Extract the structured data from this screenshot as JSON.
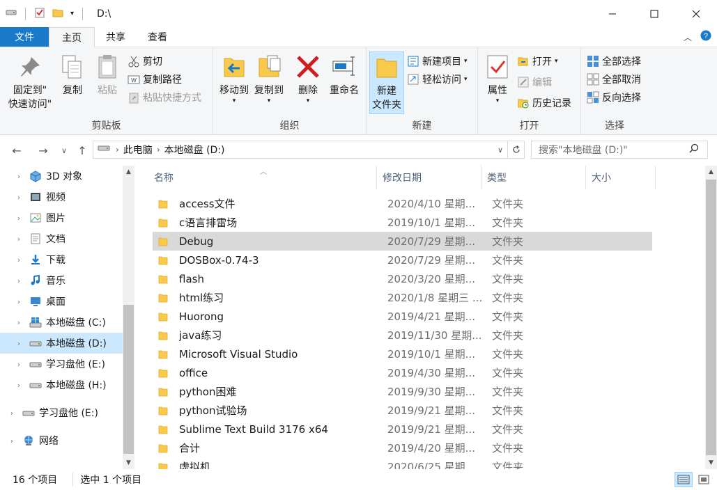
{
  "window": {
    "path_title": "D:\\"
  },
  "tabs": {
    "file": "文件",
    "home": "主页",
    "share": "共享",
    "view": "查看"
  },
  "ribbon": {
    "clipboard": {
      "label": "剪贴板",
      "pin": "固定到\"快速访问\"",
      "pin_line1": "固定到\"",
      "pin_line2": "快速访问\"",
      "copy": "复制",
      "paste": "粘贴",
      "cut": "剪切",
      "copy_path": "复制路径",
      "paste_shortcut": "粘贴快捷方式"
    },
    "organize": {
      "label": "组织",
      "move_to": "移动到",
      "copy_to": "复制到",
      "delete": "删除",
      "rename": "重命名"
    },
    "new": {
      "label": "新建",
      "new_folder_line1": "新建",
      "new_folder_line2": "文件夹",
      "new_item": "新建项目",
      "easy_access": "轻松访问"
    },
    "open": {
      "label": "打开",
      "properties": "属性",
      "open": "打开",
      "edit": "编辑",
      "history": "历史记录"
    },
    "select": {
      "label": "选择",
      "select_all": "全部选择",
      "select_none": "全部取消",
      "invert": "反向选择"
    }
  },
  "address": {
    "crumbs": [
      "此电脑",
      "本地磁盘 (D:)"
    ],
    "search_placeholder": "搜索\"本地磁盘 (D:)\""
  },
  "nav": [
    {
      "label": "3D 对象",
      "icon": "3d-objects-icon",
      "level": 1
    },
    {
      "label": "视频",
      "icon": "video-icon",
      "level": 1
    },
    {
      "label": "图片",
      "icon": "pictures-icon",
      "level": 1
    },
    {
      "label": "文档",
      "icon": "documents-icon",
      "level": 1
    },
    {
      "label": "下载",
      "icon": "downloads-icon",
      "level": 1
    },
    {
      "label": "音乐",
      "icon": "music-icon",
      "level": 1
    },
    {
      "label": "桌面",
      "icon": "desktop-icon",
      "level": 1
    },
    {
      "label": "本地磁盘 (C:)",
      "icon": "windows-drive-icon",
      "level": 1
    },
    {
      "label": "本地磁盘 (D:)",
      "icon": "drive-icon",
      "level": 1,
      "selected": true
    },
    {
      "label": "学习盘他 (E:)",
      "icon": "drive-icon",
      "level": 1
    },
    {
      "label": "本地磁盘 (H:)",
      "icon": "drive-icon",
      "level": 1
    },
    {
      "label": "学习盘他 (E:)",
      "icon": "drive-icon",
      "level": 0
    },
    {
      "label": "网络",
      "icon": "network-icon",
      "level": 0
    }
  ],
  "columns": {
    "name": "名称",
    "date": "修改日期",
    "type": "类型",
    "size": "大小"
  },
  "files": [
    {
      "name": "access文件",
      "date": "2020/4/10 星期...",
      "type": "文件夹"
    },
    {
      "name": "c语言排雷场",
      "date": "2019/10/1 星期...",
      "type": "文件夹"
    },
    {
      "name": "Debug",
      "date": "2020/7/29 星期...",
      "type": "文件夹",
      "selected": true
    },
    {
      "name": "DOSBox-0.74-3",
      "date": "2020/7/29 星期...",
      "type": "文件夹"
    },
    {
      "name": "flash",
      "date": "2020/3/20 星期...",
      "type": "文件夹"
    },
    {
      "name": "html练习",
      "date": "2020/1/8 星期三 ...",
      "type": "文件夹"
    },
    {
      "name": "Huorong",
      "date": "2019/4/21 星期...",
      "type": "文件夹"
    },
    {
      "name": "java练习",
      "date": "2019/11/30 星期...",
      "type": "文件夹"
    },
    {
      "name": "Microsoft Visual Studio",
      "date": "2019/10/1 星期...",
      "type": "文件夹"
    },
    {
      "name": "office",
      "date": "2019/4/30 星期...",
      "type": "文件夹"
    },
    {
      "name": "python困难",
      "date": "2019/9/30 星期...",
      "type": "文件夹"
    },
    {
      "name": "python试验场",
      "date": "2019/9/21 星期...",
      "type": "文件夹"
    },
    {
      "name": "Sublime Text Build 3176 x64",
      "date": "2019/9/21 星期...",
      "type": "文件夹"
    },
    {
      "name": "合计",
      "date": "2019/4/20 星期...",
      "type": "文件夹"
    },
    {
      "name": "虚拟机",
      "date": "2020/6/25 星期...",
      "type": "文件夹"
    }
  ],
  "status": {
    "count": "16 个项目",
    "selected": "选中 1 个项目"
  },
  "colors": {
    "accent": "#1979ca",
    "selection": "#cce8ff",
    "folder": "#f8c94a"
  }
}
